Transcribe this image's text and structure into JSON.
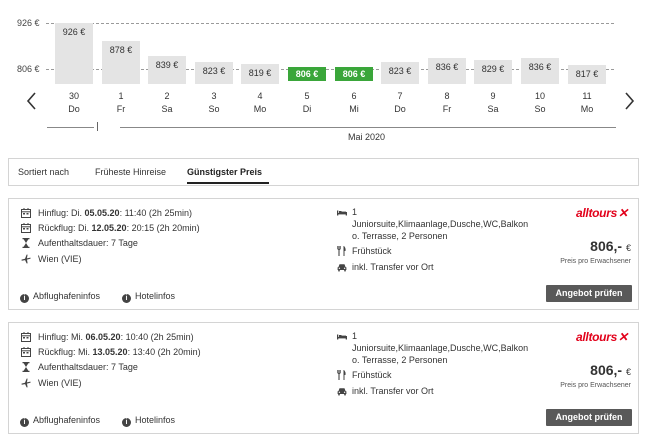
{
  "chart_data": {
    "type": "bar",
    "y_axis_labels": [
      "926 €",
      "806 €"
    ],
    "reference_lines": [
      926,
      806
    ],
    "ylim": [
      0,
      926
    ],
    "bars": [
      {
        "day": "30",
        "weekday": "Do",
        "price": 926,
        "label": "926 €",
        "cheapest": false
      },
      {
        "day": "1",
        "weekday": "Fr",
        "price": 878,
        "label": "878 €",
        "cheapest": false
      },
      {
        "day": "2",
        "weekday": "Sa",
        "price": 839,
        "label": "839 €",
        "cheapest": false
      },
      {
        "day": "3",
        "weekday": "So",
        "price": 823,
        "label": "823 €",
        "cheapest": false
      },
      {
        "day": "4",
        "weekday": "Mo",
        "price": 819,
        "label": "819 €",
        "cheapest": false
      },
      {
        "day": "5",
        "weekday": "Di",
        "price": 806,
        "label": "806 €",
        "cheapest": true
      },
      {
        "day": "6",
        "weekday": "Mi",
        "price": 806,
        "label": "806 €",
        "cheapest": true
      },
      {
        "day": "7",
        "weekday": "Do",
        "price": 823,
        "label": "823 €",
        "cheapest": false
      },
      {
        "day": "8",
        "weekday": "Fr",
        "price": 836,
        "label": "836 €",
        "cheapest": false
      },
      {
        "day": "9",
        "weekday": "Sa",
        "price": 829,
        "label": "829 €",
        "cheapest": false
      },
      {
        "day": "10",
        "weekday": "So",
        "price": 836,
        "label": "836 €",
        "cheapest": false
      },
      {
        "day": "11",
        "weekday": "Mo",
        "price": 817,
        "label": "817 €",
        "cheapest": false
      }
    ],
    "month_label": "Mai 2020",
    "colors": {
      "bar": "#e4e4e4",
      "cheapest": "#3aa63a"
    }
  },
  "sort": {
    "label": "Sortiert nach",
    "options": [
      "Früheste Hinreise",
      "Günstigster Preis"
    ],
    "active": "Günstigster Preis"
  },
  "offers": [
    {
      "outbound_prefix": "Hinflug: Di. ",
      "outbound_date": "05.05.20",
      "outbound_suffix": ": 11:40 (2h 25min)",
      "return_prefix": "Rückflug: Di. ",
      "return_date": "12.05.20",
      "return_suffix": ": 20:15 (2h 20min)",
      "duration": "Aufenthaltsdauer: 7 Tage",
      "airport": "Wien (VIE)",
      "rooms": "1",
      "room_line1": "Juniorsuite,Klimaanlage,Dusche,WC,Balkon",
      "room_line2": "o. Terrasse, 2 Personen",
      "board": "Frühstück",
      "transfer": "inkl. Transfer vor Ort",
      "operator": "alltours",
      "price": "806,-",
      "currency": "€",
      "price_note": "Preis pro Erwachsener",
      "button": "Angebot prüfen",
      "airport_info": "Abflughafeninfos",
      "hotel_info": "Hotelinfos"
    },
    {
      "outbound_prefix": "Hinflug: Mi. ",
      "outbound_date": "06.05.20",
      "outbound_suffix": ": 10:40 (2h 25min)",
      "return_prefix": "Rückflug: Mi. ",
      "return_date": "13.05.20",
      "return_suffix": ": 13:40 (2h 20min)",
      "duration": "Aufenthaltsdauer: 7 Tage",
      "airport": "Wien (VIE)",
      "rooms": "1",
      "room_line1": "Juniorsuite,Klimaanlage,Dusche,WC,Balkon",
      "room_line2": "o. Terrasse, 2 Personen",
      "board": "Frühstück",
      "transfer": "inkl. Transfer vor Ort",
      "operator": "alltours",
      "price": "806,-",
      "currency": "€",
      "price_note": "Preis pro Erwachsener",
      "button": "Angebot prüfen",
      "airport_info": "Abflughafeninfos",
      "hotel_info": "Hotelinfos"
    }
  ]
}
